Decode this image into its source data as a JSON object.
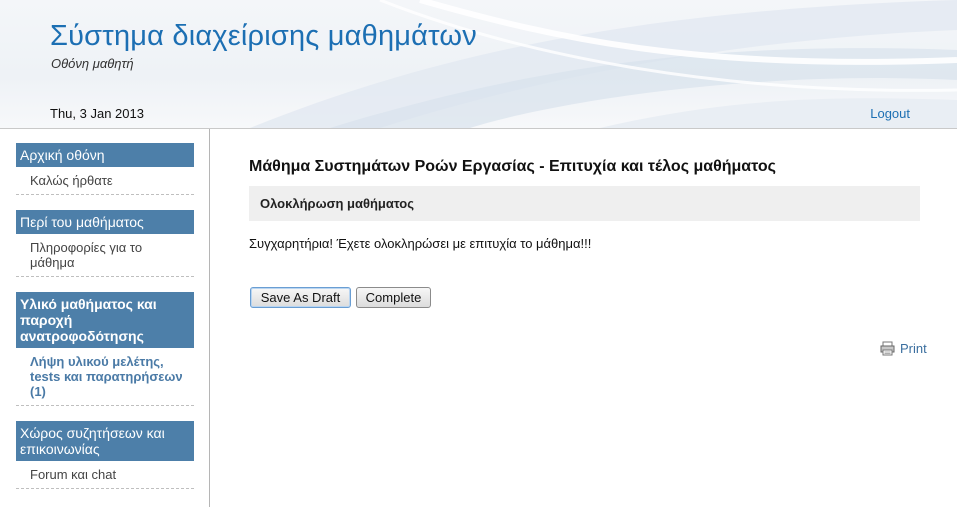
{
  "header": {
    "title": "Σύστημα διαχείρισης μαθημάτων",
    "subtitle": "Οθόνη μαθητή",
    "date": "Thu, 3 Jan 2013",
    "logout_label": "Logout"
  },
  "sidebar": {
    "sections": [
      {
        "header": "Αρχική οθόνη",
        "items": [
          "Καλώς ήρθατε"
        ]
      },
      {
        "header": "Περί του μαθήματος",
        "items": [
          "Πληροφορίες για το μάθημα"
        ]
      },
      {
        "header": "Υλικό μαθήματος και παροχή ανατροφοδότησης",
        "items": [
          "Λήψη υλικού μελέτης, tests και παρατηρήσεων (1)"
        ]
      },
      {
        "header": "Χώρος συζητήσεων και επικοινωνίας",
        "items": [
          "Forum και chat"
        ]
      }
    ]
  },
  "main": {
    "title": "Μάθημα Συστημάτων Ροών Εργασίας - Επιτυχία και τέλος μαθήματος",
    "section_title": "Ολοκλήρωση μαθήματος",
    "message": "Συγχαρητήρια! Έχετε ολοκληρώσει με επιτυχία το μάθημα!!!",
    "save_draft_label": "Save As Draft",
    "complete_label": "Complete",
    "print_label": "Print"
  },
  "colors": {
    "brand_blue": "#1c6fb3",
    "nav_header": "#4d7fa9",
    "active_item": "#4a7aa6"
  }
}
